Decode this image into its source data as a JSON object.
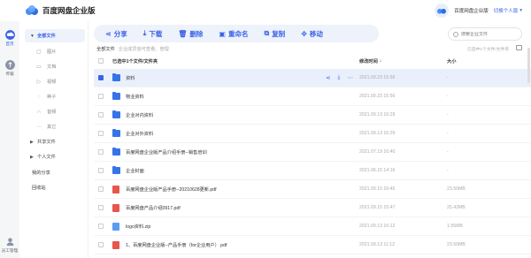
{
  "app": {
    "title": "百度网盘企业版",
    "user_name": "百度网盘企业版",
    "switch_label": "切换个人版"
  },
  "rail": [
    {
      "label": "首页",
      "icon": "cloud-icon",
      "active": true
    },
    {
      "label": "传输",
      "icon": "transfer-icon",
      "active": false
    },
    {
      "label": "员工管理",
      "icon": "staff-icon",
      "active": false
    }
  ],
  "sidebar": {
    "all_files": "全部文件",
    "categories": [
      "图片",
      "文档",
      "视频",
      "种子",
      "音频",
      "其它"
    ],
    "shared_files": "共享文件",
    "personal_files": "个人文件",
    "my_share": "我的分享",
    "recycle_bin": "回收站"
  },
  "toolbar": {
    "share": "分享",
    "download": "下载",
    "delete": "删除",
    "rename": "重命名",
    "copy": "复制",
    "move": "移动"
  },
  "search": {
    "placeholder": "搜索企业文件"
  },
  "breadcrumb": {
    "current": "全部文件",
    "description": "企业成员皆可查看、管理"
  },
  "count_info": "已选中1个文件/文件夹",
  "table": {
    "header_name": "已选中1个文件/文件夹",
    "header_time": "修改时间",
    "header_size": "大小"
  },
  "files": [
    {
      "name": "资料",
      "type": "folder",
      "time": "2021.09.23 15:56",
      "size": "-",
      "selected": true
    },
    {
      "name": "物业资料",
      "type": "folder",
      "time": "2021.09.23 15:56",
      "size": "-",
      "selected": false
    },
    {
      "name": "企业对内资料",
      "type": "folder",
      "time": "2021.09.13 16:29",
      "size": "-",
      "selected": false
    },
    {
      "name": "企业对外资料",
      "type": "folder",
      "time": "2021.09.13 16:29",
      "size": "-",
      "selected": false
    },
    {
      "name": "百度网盘企业版产品介绍手册--销售培训",
      "type": "folder",
      "time": "2021.07.19 16:40",
      "size": "-",
      "selected": false
    },
    {
      "name": "企业封面",
      "type": "folder",
      "time": "2021.06.15 14:16",
      "size": "-",
      "selected": false
    },
    {
      "name": "百度网盘企业版产品手册--20210628更新.pdf",
      "type": "pdf",
      "time": "2021.09.15 16:45",
      "size": "23.50MB",
      "selected": false
    },
    {
      "name": "百度网盘产品介绍0917.pdf",
      "type": "pdf",
      "time": "2021.09.15 15:47",
      "size": "25.42MB",
      "selected": false
    },
    {
      "name": "logo资料.zip",
      "type": "zip",
      "time": "2021.09.13 16:12",
      "size": "1.55MB",
      "selected": false
    },
    {
      "name": "1、百度网盘企业版--产品手册（for企业用户）.pdf",
      "type": "pdf",
      "time": "2021.09.13 11:12",
      "size": "23.50MB",
      "selected": false
    }
  ],
  "colors": {
    "accent": "#3a63e6",
    "folder": "#3574e8",
    "pdf": "#e8554c",
    "zip": "#5b9cf2"
  }
}
